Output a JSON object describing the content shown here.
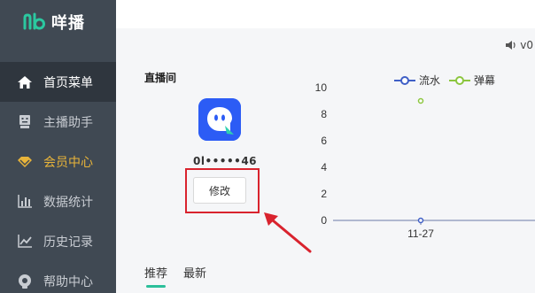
{
  "app": {
    "name": "咩播"
  },
  "sidebar": {
    "items": [
      {
        "label": "首页菜单",
        "icon": "home-icon",
        "active": true
      },
      {
        "label": "主播助手",
        "icon": "robot-icon"
      },
      {
        "label": "会员中心",
        "icon": "vip-diamond-icon",
        "color": "#e8b43a"
      },
      {
        "label": "数据统计",
        "icon": "bar-chart-icon"
      },
      {
        "label": "历史记录",
        "icon": "line-chart-icon"
      },
      {
        "label": "帮助中心",
        "icon": "help-icon"
      }
    ]
  },
  "header": {
    "version": "v0"
  },
  "room": {
    "title": "直播间",
    "id_text": "0l•••••46",
    "edit_label": "修改"
  },
  "tabs": [
    {
      "label": "推荐",
      "active": true
    },
    {
      "label": "最新"
    }
  ],
  "chart_data": {
    "type": "line",
    "categories": [
      "11-27"
    ],
    "series": [
      {
        "name": "流水",
        "values": [
          0
        ],
        "color": "#3f5fc6"
      },
      {
        "name": "弹幕",
        "values": [
          9
        ],
        "color": "#8cc63f"
      }
    ],
    "ylim": [
      0,
      10
    ],
    "yticks": [
      0,
      2,
      4,
      6,
      8,
      10
    ],
    "legend": "top"
  },
  "colors": {
    "sidebar": "#404953",
    "accent": "#2bbf9a",
    "highlight": "#d9232e"
  }
}
